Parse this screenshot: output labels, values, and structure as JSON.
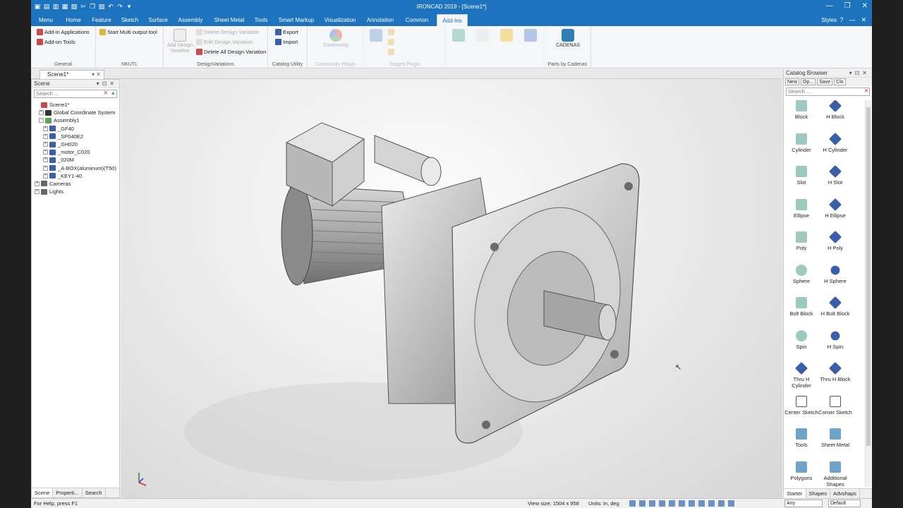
{
  "window": {
    "title": "IRONCAD 2019 - [Scene1*]",
    "controls": [
      "—",
      "❐",
      "✕"
    ]
  },
  "tabs": [
    {
      "label": "Menu"
    },
    {
      "label": "Home"
    },
    {
      "label": "Feature"
    },
    {
      "label": "Sketch"
    },
    {
      "label": "Surface"
    },
    {
      "label": "Assembly"
    },
    {
      "label": "Sheet Metal"
    },
    {
      "label": "Tools"
    },
    {
      "label": "Smart Markup"
    },
    {
      "label": "Visualization"
    },
    {
      "label": "Annotation"
    },
    {
      "label": "Common"
    },
    {
      "label": "Add-Ins",
      "active": true
    }
  ],
  "styles_label": "Styles",
  "ribbon": {
    "general": {
      "label": "General",
      "add_in_apps": "Add-in Applications",
      "add_on_tools": "Add-on Tools"
    },
    "nkutl": {
      "label": "NKUTL",
      "start_multi": "Start Multi output tool"
    },
    "design_variations": {
      "label": "DesignVariations",
      "add_btn": "Add Design Variation",
      "delete": "Delete Design Variation",
      "edit": "Edit Design Variation",
      "delete_all": "Delete All Design Variation"
    },
    "catalog_utility": {
      "label": "Catalog Utility",
      "export": "Export",
      "import": "Import"
    },
    "community": {
      "label": "Community Plugin",
      "btn": "Community"
    },
    "tagged": {
      "label": "Tagged Plugin"
    },
    "cadenas": {
      "label": "Parts by Cadenas",
      "btn": "CADENAS"
    }
  },
  "document": {
    "tab": "Scene1*"
  },
  "scene_panel": {
    "title": "Scene",
    "search_placeholder": "Search ...",
    "tree": [
      {
        "label": "Scene1*",
        "depth": 0,
        "icon": "scene-icon",
        "expand": ""
      },
      {
        "label": "Global Coordinate System",
        "depth": 1,
        "icon": "coordinate-icon",
        "expand": "+"
      },
      {
        "label": "Assembly1",
        "depth": 1,
        "icon": "assembly-icon",
        "expand": "−"
      },
      {
        "label": "_GF40",
        "depth": 2,
        "icon": "part-icon",
        "expand": "+"
      },
      {
        "label": "_SP040E2",
        "depth": 2,
        "icon": "part-icon",
        "expand": "+"
      },
      {
        "label": "_GH020",
        "depth": 2,
        "icon": "part-icon",
        "expand": "+"
      },
      {
        "label": "_motor_C020",
        "depth": 2,
        "icon": "part-icon",
        "expand": "+"
      },
      {
        "label": "_020M",
        "depth": 2,
        "icon": "part-icon",
        "expand": "+"
      },
      {
        "label": "_A-BOX(aluminum)(T50)",
        "depth": 2,
        "icon": "part-icon",
        "expand": "+"
      },
      {
        "label": "_KEY1-40",
        "depth": 2,
        "icon": "part-icon",
        "expand": "+"
      },
      {
        "label": "Cameras",
        "depth": 0,
        "icon": "camera-icon",
        "expand": "+"
      },
      {
        "label": "Lights",
        "depth": 0,
        "icon": "light-icon",
        "expand": "+"
      }
    ],
    "bottom_tabs": [
      "Scene",
      "Properti...",
      "Search"
    ]
  },
  "catalog": {
    "title": "Catalog Browser",
    "tools": [
      "New",
      "Op...",
      "Save",
      "Clo"
    ],
    "search_placeholder": "Search ...",
    "shapes": [
      {
        "label": "Block",
        "icon": "block-icon",
        "color": "#9fc8c0"
      },
      {
        "label": "H Block",
        "icon": "h-block-icon",
        "color": "#3b5ea8"
      },
      {
        "label": "Cylinder",
        "icon": "cylinder-icon",
        "color": "#9fc8c0"
      },
      {
        "label": "H Cylinder",
        "icon": "h-cylinder-icon",
        "color": "#3b5ea8"
      },
      {
        "label": "Slot",
        "icon": "slot-icon",
        "color": "#9fc8c0"
      },
      {
        "label": "H Slot",
        "icon": "h-slot-icon",
        "color": "#3b5ea8"
      },
      {
        "label": "Ellipse",
        "icon": "ellipse-icon",
        "color": "#9fc8c0"
      },
      {
        "label": "H Ellipse",
        "icon": "h-ellipse-icon",
        "color": "#3b5ea8"
      },
      {
        "label": "Poly",
        "icon": "poly-icon",
        "color": "#9fc8c0"
      },
      {
        "label": "H Poly",
        "icon": "h-poly-icon",
        "color": "#3b5ea8"
      },
      {
        "label": "Sphere",
        "icon": "sphere-icon",
        "color": "#9fc8c0"
      },
      {
        "label": "H Sphere",
        "icon": "h-sphere-icon",
        "color": "#3b5ea8"
      },
      {
        "label": "Bolt Block",
        "icon": "bolt-block-icon",
        "color": "#9fc8c0"
      },
      {
        "label": "H Bolt Block",
        "icon": "h-bolt-block-icon",
        "color": "#3b5ea8"
      },
      {
        "label": "Spin",
        "icon": "spin-icon",
        "color": "#9fc8c0"
      },
      {
        "label": "H Spin",
        "icon": "h-spin-icon",
        "color": "#3b5ea8"
      },
      {
        "label": "Thru H Cylinder",
        "icon": "thru-h-cylinder-icon",
        "color": "#3b5ea8"
      },
      {
        "label": "Thru H Block",
        "icon": "thru-h-block-icon",
        "color": "#3b5ea8"
      },
      {
        "label": "Center Sketch",
        "icon": "center-sketch-icon",
        "color": "#555555"
      },
      {
        "label": "Corner Sketch",
        "icon": "corner-sketch-icon",
        "color": "#555555"
      },
      {
        "label": "Tools",
        "icon": "tools-folder-icon",
        "color": "#6fa3c9"
      },
      {
        "label": "Sheet Metal",
        "icon": "sheet-metal-folder-icon",
        "color": "#6fa3c9"
      },
      {
        "label": "Polygons",
        "icon": "polygons-folder-icon",
        "color": "#6fa3c9"
      },
      {
        "label": "Additional Shapes",
        "icon": "additional-shapes-folder-icon",
        "color": "#6fa3c9"
      }
    ],
    "bottom_tabs": [
      "Starter",
      "Shapes",
      "Advshaps"
    ]
  },
  "status": {
    "help": "For Help, press F1",
    "view_size": "View size: 1504 x 958",
    "units": "Units: in, deg",
    "filter": "Any",
    "style": "Default"
  },
  "colors": {
    "accent": "#1e73be"
  }
}
